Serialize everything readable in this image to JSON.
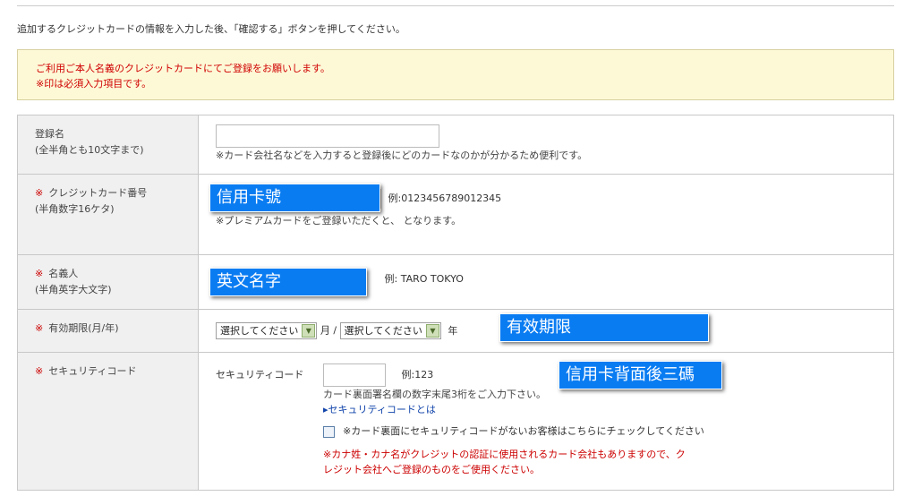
{
  "intro": "追加するクレジットカードの情報を入力した後、「確認する」ボタンを押してください。",
  "notice": {
    "line1": "ご利用ご本人名義のクレジットカードにてご登録をお願いします。",
    "line2": "※印は必須入力項目です。"
  },
  "rows": {
    "name": {
      "label": "登録名",
      "sub": "(全半角とも10文字まで)",
      "note": "※カード会社名などを入力すると登録後にどのカードなのかが分かるため便利です。"
    },
    "card": {
      "req": "※",
      "label": "クレジットカード番号",
      "sub": "(半角数字16ケタ)",
      "example": "例:0123456789012345",
      "note": "※プレミアムカードをご登録いただくと、 となります。"
    },
    "holder": {
      "req": "※",
      "label": "名義人",
      "sub": "(半角英字大文字)",
      "example": "例: TARO TOKYO"
    },
    "expiry": {
      "req": "※",
      "label": "有効期限(月/年)",
      "month_select": "選択してください",
      "month_unit": "月 /",
      "year_select": "選択してください",
      "year_unit": "年"
    },
    "security": {
      "req": "※",
      "label": "セキュリティコード",
      "field_label": "セキュリティコード",
      "example": "例:123",
      "note": "カード裏面署名欄の数字末尾3桁をご入力下さい。",
      "link": "▸セキュリティコードとは",
      "checkbox_label": "※カード裏面にセキュリティコードがないお客様はこちらにチェックしてください",
      "warning_line1": "※カナ姓・カナ名がクレジットの認証に使用されるカード会社もありますので、ク",
      "warning_line2": "レジット会社へご登録のものをご使用ください。"
    }
  },
  "overlays": {
    "card": "信用卡號",
    "holder": "英文名字",
    "expiry": "有效期限",
    "security": "信用卡背面後三碼"
  },
  "colors": {
    "accent_overlay": "#0a7cf2",
    "required": "#cc0000",
    "notice_bg": "#fdf9d7"
  }
}
